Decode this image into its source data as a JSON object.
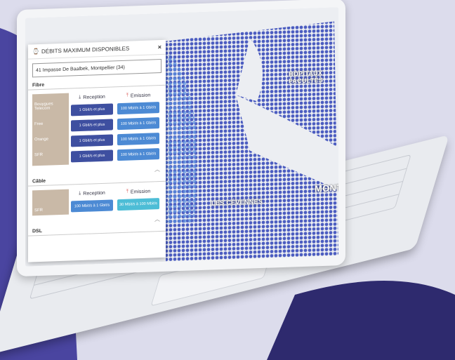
{
  "panel": {
    "title": "DÉBITS MAXIMUM DISPONIBLES",
    "address": "41 Impasse De Baalbek, Montpellier (34)",
    "close_glyph": "×",
    "fibre": {
      "label": "Fibre",
      "reception_header": "Reception",
      "emission_header": "Emission",
      "operators": [
        "Bouygues Telecom",
        "Free",
        "Orange",
        "SFR"
      ],
      "reception": [
        "1 Gbit/s et plus",
        "1 Gbit/s et plus",
        "1 Gbit/s et plus",
        "1 Gbit/s et plus"
      ],
      "emission": [
        "100 Mbit/s à 1 Gbit/s",
        "100 Mbit/s à 1 Gbit/s",
        "100 Mbit/s à 1 Gbit/s",
        "100 Mbit/s à 1 Gbit/s"
      ]
    },
    "cable": {
      "label": "Câble",
      "reception_header": "Reception",
      "emission_header": "Emission",
      "operators": [
        "SFR"
      ],
      "reception": [
        "100 Mbit/s à 1 Gbit/s"
      ],
      "emission": [
        "30 Mbit/s à 100 Mbit/s"
      ]
    },
    "dsl": {
      "label": "DSL"
    }
  },
  "map": {
    "labels": [
      "HÔPITAUX FACULTÉS",
      "LES CÉVENNES",
      "MONT"
    ]
  },
  "colors": {
    "background": "#dcdcec",
    "accent_dark": "#2e2a6e",
    "button_dark": "#3e4fa0",
    "button_light": "#4c8ad4",
    "button_teal": "#4dbdd6",
    "operator_bar": "#c9b9a7"
  },
  "icons": {
    "title": "speed-icon",
    "reception": "download-icon",
    "emission": "upload-icon",
    "close": "close-icon",
    "collapse": "chevron-up-icon"
  }
}
